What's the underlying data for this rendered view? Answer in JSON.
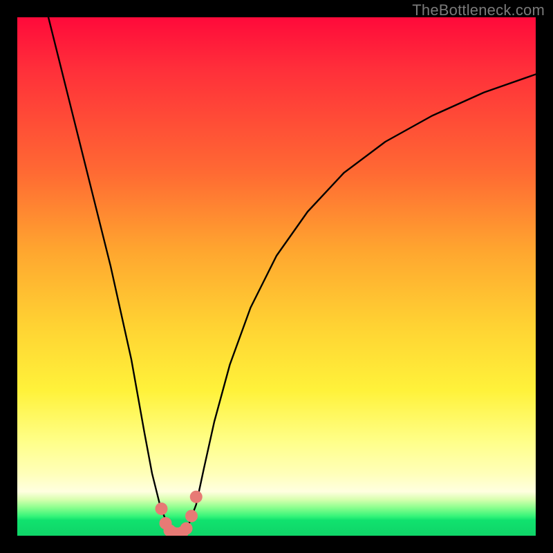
{
  "watermark": "TheBottleneck.com",
  "chart_data": {
    "type": "line",
    "title": "",
    "xlabel": "",
    "ylabel": "",
    "xlim": [
      0,
      100
    ],
    "ylim": [
      0,
      100
    ],
    "series": [
      {
        "name": "curve",
        "x": [
          6,
          10,
          14,
          18,
          22,
          24.5,
          26,
          27.5,
          29,
          30,
          31,
          32,
          33,
          34.5,
          36,
          38,
          41,
          45,
          50,
          56,
          63,
          71,
          80,
          90,
          100
        ],
        "y": [
          100,
          84,
          68,
          52,
          34,
          20,
          12,
          6,
          2,
          0.5,
          0,
          0.5,
          2,
          6,
          13,
          22,
          33,
          44,
          54,
          62.5,
          70,
          76,
          81,
          85.5,
          89
        ]
      }
    ],
    "markers": {
      "name": "highlight-dots",
      "color": "#e77a75",
      "x": [
        27.8,
        28.6,
        29.4,
        30.2,
        31.0,
        31.8,
        32.6,
        33.6,
        34.5
      ],
      "y": [
        5.2,
        2.4,
        1.0,
        0.5,
        0.4,
        0.6,
        1.4,
        3.8,
        7.5
      ]
    },
    "gradient_stops": [
      {
        "pct": 0,
        "color": "#ff0a3a"
      },
      {
        "pct": 30,
        "color": "#ff6a33"
      },
      {
        "pct": 60,
        "color": "#ffd433"
      },
      {
        "pct": 82,
        "color": "#ffff8a"
      },
      {
        "pct": 95,
        "color": "#8fff8f"
      },
      {
        "pct": 100,
        "color": "#0fd468"
      }
    ]
  }
}
